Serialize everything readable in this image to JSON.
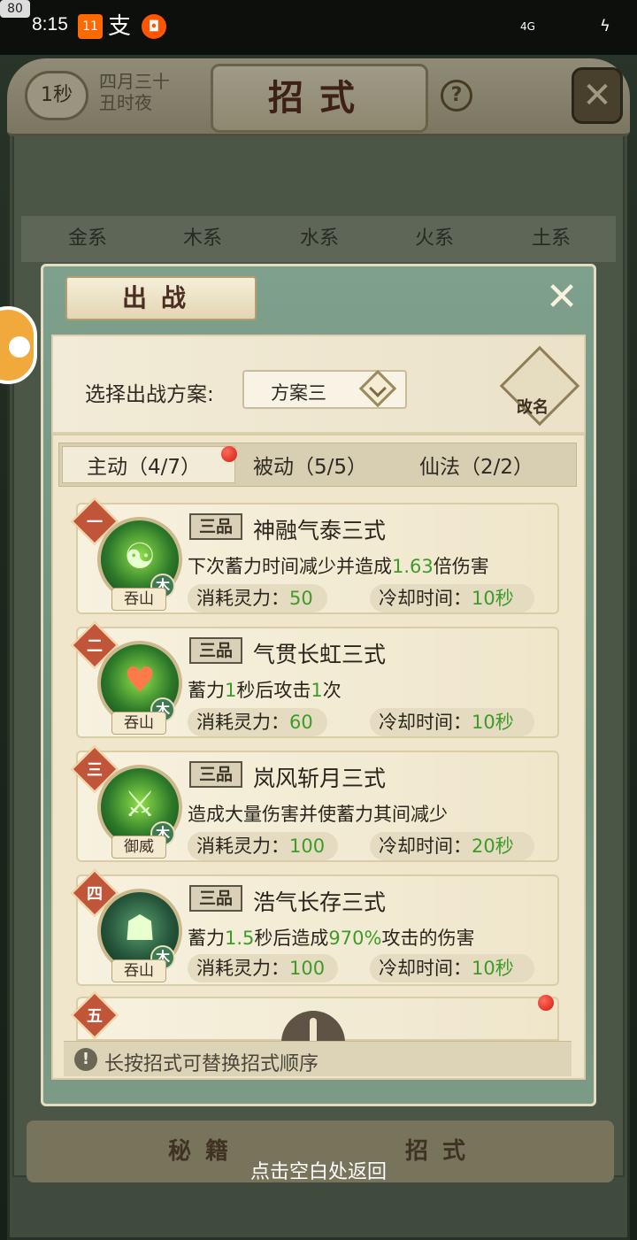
{
  "status_bar": {
    "time": "8:15",
    "app_icons": [
      "mi-icon",
      "alipay-icon",
      "taobao-icon"
    ],
    "signal": "4G",
    "battery": "80"
  },
  "background": {
    "timer": "1秒",
    "date_line1": "四月三十",
    "date_line2": "丑时夜",
    "title": "招式",
    "help": "?",
    "elements": [
      "金系",
      "木系",
      "水系",
      "火系",
      "土系"
    ],
    "bottom_tabs": [
      "秘籍",
      "招式"
    ],
    "back_hint": "点击空白处返回"
  },
  "dialog": {
    "title": "出战",
    "plan_label": "选择出战方案:",
    "plan_value": "方案三",
    "rename_label": "改名",
    "tabs": [
      {
        "label": "主动（4/7）"
      },
      {
        "label": "被动（5/5）"
      },
      {
        "label": "仙法（2/2）"
      }
    ],
    "skills": [
      {
        "order": "一",
        "grade": "三品",
        "name": "神融气泰三式",
        "desc_a": "下次蓄力时间减少并造成",
        "desc_hl1": "1.63",
        "desc_b": "倍伤害",
        "desc_hl2": "",
        "desc_c": "",
        "cost_label": "消耗灵力：",
        "cost": "50",
        "cd_label": "冷却时间：",
        "cd": "10秒",
        "school": "吞山",
        "element": "木",
        "icon": "meditating-figure-icon"
      },
      {
        "order": "二",
        "grade": "三品",
        "name": "气贯长虹三式",
        "desc_a": "蓄力",
        "desc_hl1": "1",
        "desc_b": "秒后攻击",
        "desc_hl2": "1",
        "desc_c": "次",
        "cost_label": "消耗灵力：",
        "cost": "60",
        "cd_label": "冷却时间：",
        "cd": "10秒",
        "school": "吞山",
        "element": "木",
        "icon": "heart-swirl-icon"
      },
      {
        "order": "三",
        "grade": "三品",
        "name": "岚风斩月三式",
        "desc_a": "造成大量伤害并使蓄力其间减少",
        "desc_hl1": "",
        "desc_b": "",
        "desc_hl2": "",
        "desc_c": "",
        "cost_label": "消耗灵力：",
        "cost": "100",
        "cd_label": "冷却时间：",
        "cd": "20秒",
        "school": "御威",
        "element": "木",
        "icon": "green-blade-icon"
      },
      {
        "order": "四",
        "grade": "三品",
        "name": "浩气长存三式",
        "desc_a": "蓄力",
        "desc_hl1": "1.5",
        "desc_b": "秒后造成",
        "desc_hl2": "970%",
        "desc_c": "攻击的伤害",
        "cost_label": "消耗灵力：",
        "cost": "100",
        "cd_label": "冷却时间：",
        "cd": "10秒",
        "school": "吞山",
        "element": "木",
        "icon": "swordsman-icon"
      }
    ],
    "empty_slot_order": "五",
    "tip": "长按招式可替换招式顺序"
  }
}
